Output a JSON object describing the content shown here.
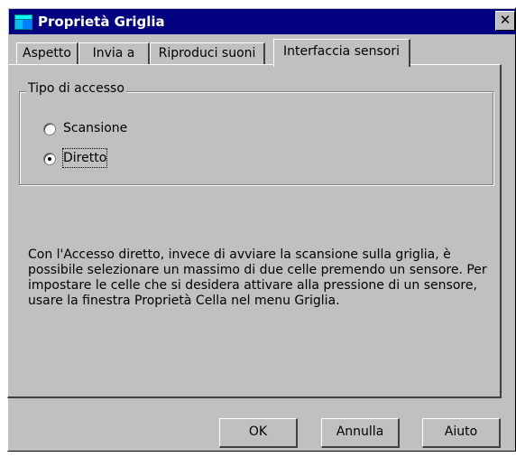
{
  "window": {
    "title": "Proprietà Griglia",
    "close_label": "✕"
  },
  "tabs": [
    {
      "label": "Aspetto",
      "active": false
    },
    {
      "label": "Invia a",
      "active": false
    },
    {
      "label": "Riproduci suoni",
      "active": false
    },
    {
      "label": "Interfaccia sensori",
      "active": true
    }
  ],
  "access_group": {
    "legend": "Tipo di accesso",
    "options": [
      {
        "label": "Scansione",
        "selected": false
      },
      {
        "label": "Diretto",
        "selected": true
      }
    ]
  },
  "description": "Con l'Accesso diretto, invece di avviare la scansione sulla griglia, è possibile selezionare un massimo di due celle premendo un sensore. Per impostare le celle che si desidera attivare alla pressione di un sensore, usare la finestra Proprietà Cella nel menu Griglia.",
  "buttons": {
    "ok": "OK",
    "cancel": "Annulla",
    "help": "Aiuto"
  },
  "colors": {
    "titlebar": "#000080",
    "face": "#c0c0c0"
  },
  "icons": {
    "app": "grid-app-icon",
    "close": "close-icon"
  }
}
